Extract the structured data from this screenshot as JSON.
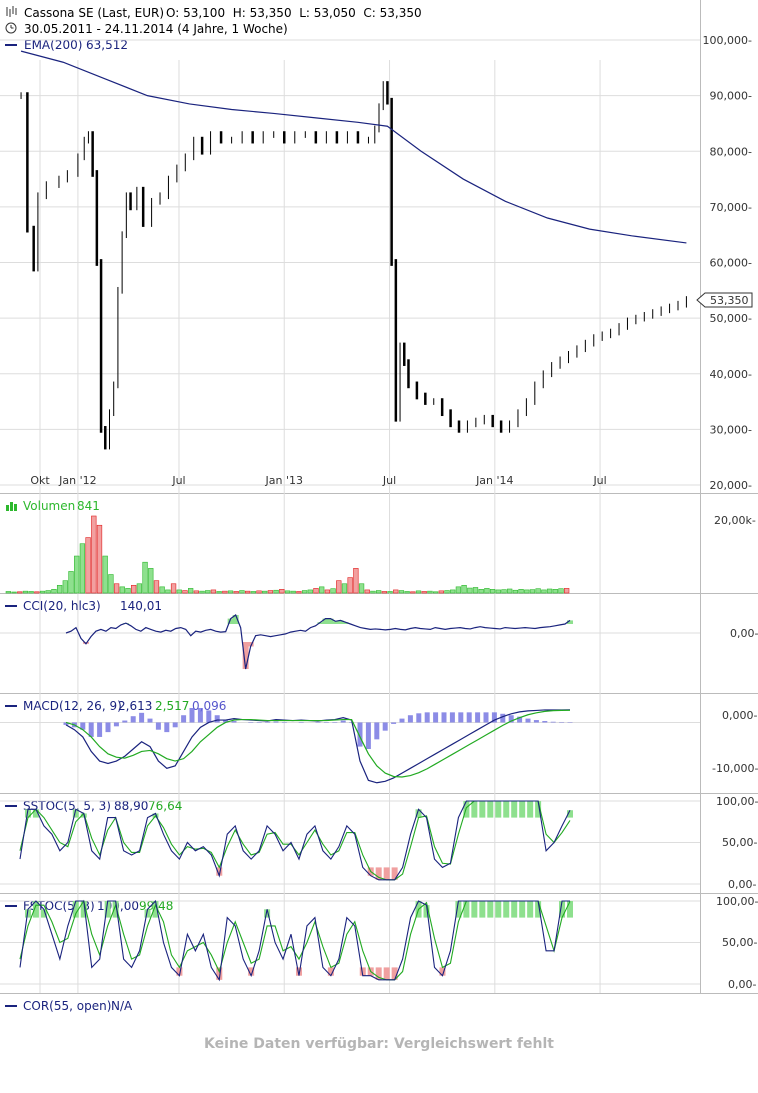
{
  "header": {
    "title": "Cassona SE (Last, EUR)",
    "ohlc": "O: 53,100  H: 53,350  L: 53,050  C: 53,350",
    "range": "30.05.2011 - 24.11.2014 (4 Jahre, 1 Woche)"
  },
  "colors": {
    "ema": "#1a237e",
    "volume_up": "#2db82d",
    "volume_down": "#e02020",
    "fill_positive": "#8ee08e",
    "fill_negative": "#f0a0a0",
    "macd_hist": "#6666dd",
    "signal": "#22aa22",
    "grid": "#dddddd"
  },
  "panels": {
    "price": {
      "ema_label": "EMA(200)",
      "ema_value": "63,512",
      "last_price_tag": "53,350",
      "y_ticks": [
        "100,000-",
        "90,000-",
        "80,000-",
        "70,000-",
        "60,000-",
        "50,000-",
        "40,000-",
        "30,000-",
        "20,000-"
      ],
      "x_ticks": [
        "Okt",
        "Jan '12",
        "Jul",
        "Jan '13",
        "Jul",
        "Jan '14",
        "Jul"
      ]
    },
    "volume": {
      "label": "Volumen",
      "value": "841",
      "y_ticks": [
        "20,00k-"
      ]
    },
    "cci": {
      "label": "CCI(20, hlc3)",
      "value": "140,01",
      "y_ticks": [
        "0,00-"
      ]
    },
    "macd": {
      "label": "MACD(12, 26, 9)",
      "value1": "2,613",
      "value2": "2,517",
      "value3": "0,096",
      "y_ticks": [
        "0,000-",
        "-10,000-"
      ]
    },
    "sstoc": {
      "label": "SSTOC(5, 5, 3)",
      "value1": "88,90",
      "value2": "76,64",
      "y_ticks": [
        "100,00-",
        "50,00-",
        "0,00-"
      ]
    },
    "fstoc": {
      "label": "FSTOC(5, 3)",
      "value1": "100,00",
      "value2": "99,48",
      "y_ticks": [
        "100,00-",
        "50,00-",
        "0,00-"
      ]
    },
    "cor": {
      "label": "COR(55, open)",
      "value": "N/A",
      "note": "Keine Daten verfügbar: Vergleichswert fehlt"
    }
  },
  "chart_data": [
    {
      "type": "line",
      "panel": "price",
      "ylim": [
        20,
        100
      ],
      "x_tick_positions": [
        0.09,
        0.27,
        0.75,
        1.25,
        1.75,
        2.25,
        2.75
      ],
      "xlim": [
        -0.1,
        3.5
      ],
      "close": [
        [
          0.0,
          90.0
        ],
        [
          0.03,
          66.0
        ],
        [
          0.06,
          59.0
        ],
        [
          0.08,
          72.0
        ],
        [
          0.12,
          74.0
        ],
        [
          0.18,
          75.0
        ],
        [
          0.22,
          76.0
        ],
        [
          0.27,
          79.0
        ],
        [
          0.3,
          82.0
        ],
        [
          0.32,
          83.0
        ],
        [
          0.34,
          76.0
        ],
        [
          0.36,
          60.0
        ],
        [
          0.38,
          30.0
        ],
        [
          0.4,
          27.0
        ],
        [
          0.42,
          33.0
        ],
        [
          0.44,
          38.0
        ],
        [
          0.46,
          55.0
        ],
        [
          0.48,
          65.0
        ],
        [
          0.5,
          72.0
        ],
        [
          0.52,
          70.0
        ],
        [
          0.55,
          73.0
        ],
        [
          0.58,
          67.0
        ],
        [
          0.62,
          71.0
        ],
        [
          0.66,
          72.0
        ],
        [
          0.7,
          75.0
        ],
        [
          0.74,
          77.0
        ],
        [
          0.78,
          79.0
        ],
        [
          0.82,
          82.0
        ],
        [
          0.86,
          80.0
        ],
        [
          0.9,
          83.0
        ],
        [
          0.95,
          82.0
        ],
        [
          1.0,
          82.0
        ],
        [
          1.05,
          83.0
        ],
        [
          1.1,
          82.0
        ],
        [
          1.15,
          83.0
        ],
        [
          1.2,
          83.0
        ],
        [
          1.25,
          82.0
        ],
        [
          1.3,
          83.0
        ],
        [
          1.35,
          83.0
        ],
        [
          1.4,
          82.0
        ],
        [
          1.45,
          83.0
        ],
        [
          1.5,
          82.0
        ],
        [
          1.55,
          83.0
        ],
        [
          1.6,
          82.0
        ],
        [
          1.65,
          82.0
        ],
        [
          1.68,
          84.0
        ],
        [
          1.7,
          88.0
        ],
        [
          1.72,
          92.0
        ],
        [
          1.74,
          89.0
        ],
        [
          1.76,
          60.0
        ],
        [
          1.78,
          32.0
        ],
        [
          1.8,
          45.0
        ],
        [
          1.82,
          42.0
        ],
        [
          1.84,
          38.0
        ],
        [
          1.88,
          36.0
        ],
        [
          1.92,
          35.0
        ],
        [
          1.96,
          35.0
        ],
        [
          2.0,
          33.0
        ],
        [
          2.04,
          31.0
        ],
        [
          2.08,
          30.0
        ],
        [
          2.12,
          31.0
        ],
        [
          2.16,
          31.5
        ],
        [
          2.2,
          32.0
        ],
        [
          2.24,
          31.0
        ],
        [
          2.28,
          30.0
        ],
        [
          2.32,
          31.0
        ],
        [
          2.36,
          33.0
        ],
        [
          2.4,
          35.0
        ],
        [
          2.44,
          38.0
        ],
        [
          2.48,
          40.0
        ],
        [
          2.52,
          41.5
        ],
        [
          2.56,
          42.5
        ],
        [
          2.6,
          43.5
        ],
        [
          2.64,
          44.5
        ],
        [
          2.68,
          45.5
        ],
        [
          2.72,
          46.5
        ],
        [
          2.76,
          47.0
        ],
        [
          2.8,
          47.5
        ],
        [
          2.84,
          48.5
        ],
        [
          2.88,
          49.5
        ],
        [
          2.92,
          50.0
        ],
        [
          2.96,
          50.5
        ],
        [
          3.0,
          51.0
        ],
        [
          3.04,
          51.5
        ],
        [
          3.08,
          52.0
        ],
        [
          3.12,
          52.5
        ],
        [
          3.16,
          53.35
        ]
      ],
      "ema200": [
        [
          0.0,
          98.0
        ],
        [
          0.2,
          96.0
        ],
        [
          0.4,
          93.0
        ],
        [
          0.6,
          90.0
        ],
        [
          0.8,
          88.5
        ],
        [
          1.0,
          87.5
        ],
        [
          1.2,
          86.8
        ],
        [
          1.4,
          86.0
        ],
        [
          1.6,
          85.2
        ],
        [
          1.74,
          84.5
        ],
        [
          1.9,
          80.0
        ],
        [
          2.1,
          75.0
        ],
        [
          2.3,
          71.0
        ],
        [
          2.5,
          68.0
        ],
        [
          2.7,
          66.0
        ],
        [
          2.9,
          64.8
        ],
        [
          3.16,
          63.512
        ]
      ]
    },
    {
      "type": "bar",
      "panel": "volume",
      "ylim": [
        0,
        25
      ],
      "values": [
        0.5,
        0.3,
        0.4,
        0.6,
        0.5,
        0.4,
        0.6,
        0.8,
        1.2,
        2.5,
        4.0,
        7.0,
        12.0,
        16.0,
        18.0,
        25.0,
        22.0,
        12.0,
        6.0,
        3.0,
        2.0,
        1.5,
        2.5,
        3.0,
        10.0,
        8.0,
        4.0,
        2.0,
        1.0,
        3.0,
        1.0,
        0.8,
        1.5,
        0.7,
        0.6,
        0.8,
        1.0,
        0.5,
        0.6,
        0.7,
        0.5,
        0.8,
        0.6,
        0.5,
        0.7,
        0.6,
        0.8,
        0.9,
        1.2,
        0.7,
        0.6,
        0.5,
        0.8,
        1.0,
        1.5,
        2.0,
        1.0,
        1.4,
        4.0,
        3.0,
        5.0,
        8.0,
        3.0,
        1.0,
        0.6,
        0.8,
        0.5,
        0.5,
        1.0,
        0.8,
        0.5,
        0.4,
        0.7,
        0.5,
        0.6,
        0.4,
        0.7,
        0.8,
        1.0,
        2.0,
        2.5,
        1.6,
        1.8,
        1.2,
        1.5,
        1.2,
        1.0,
        1.1,
        1.3,
        0.9,
        1.2,
        1.0,
        1.1,
        1.4,
        1.0,
        1.3,
        1.2,
        1.4,
        1.5
      ],
      "up": [
        1,
        1,
        0,
        1,
        1,
        0,
        1,
        1,
        1,
        1,
        1,
        1,
        1,
        1,
        0,
        0,
        0,
        1,
        1,
        0,
        1,
        1,
        0,
        1,
        1,
        1,
        0,
        1,
        1,
        0,
        1,
        0,
        1,
        0,
        1,
        1,
        0,
        1,
        0,
        1,
        0,
        1,
        0,
        1,
        0,
        1,
        0,
        1,
        0,
        1,
        1,
        0,
        1,
        1,
        0,
        1,
        0,
        1,
        0,
        1,
        0,
        0,
        1,
        0,
        1,
        1,
        0,
        1,
        0,
        1,
        1,
        0,
        1,
        0,
        1,
        1,
        0,
        1,
        1,
        1,
        1,
        1,
        1,
        1,
        1,
        1,
        1,
        1,
        1,
        1,
        1,
        1,
        1,
        1,
        1,
        1,
        1,
        1
      ]
    },
    {
      "type": "line",
      "panel": "cci",
      "ylim": [
        -300,
        300
      ],
      "values": [
        0,
        20,
        60,
        -60,
        -120,
        -40,
        20,
        40,
        20,
        60,
        50,
        90,
        110,
        80,
        40,
        20,
        60,
        40,
        20,
        10,
        30,
        20,
        50,
        60,
        40,
        -30,
        20,
        10,
        30,
        40,
        20,
        10,
        15,
        160,
        200,
        60,
        -400,
        -150,
        -30,
        -20,
        -30,
        -40,
        -30,
        -20,
        -10,
        10,
        20,
        30,
        20,
        60,
        80,
        120,
        160,
        160,
        130,
        140,
        120,
        100,
        80,
        60,
        50,
        40,
        45,
        40,
        35,
        40,
        50,
        40,
        35,
        50,
        60,
        50,
        45,
        40,
        60,
        50,
        40,
        50,
        55,
        60,
        50,
        45,
        60,
        70,
        60,
        55,
        50,
        45,
        60,
        55,
        50,
        55,
        60,
        55,
        50,
        60,
        65,
        70,
        80,
        90,
        100,
        140.01
      ]
    },
    {
      "type": "line",
      "panel": "macd",
      "ylim": [
        -14,
        3
      ],
      "macd": [
        -0.5,
        -1.5,
        -3.0,
        -6.0,
        -8.0,
        -8.5,
        -8.0,
        -7.0,
        -5.5,
        -4.0,
        -5.0,
        -8.0,
        -9.5,
        -9.0,
        -6.0,
        -3.0,
        -1.0,
        0.0,
        0.5,
        0.5,
        0.8,
        0.6,
        0.5,
        0.4,
        0.3,
        0.6,
        0.5,
        0.4,
        0.5,
        0.4,
        0.3,
        0.5,
        0.6,
        1.0,
        0.5,
        -8.0,
        -12.0,
        -12.5,
        -12.2,
        -11.5,
        -10.5,
        -9.5,
        -8.5,
        -7.5,
        -6.5,
        -5.5,
        -4.5,
        -3.5,
        -2.5,
        -1.5,
        -0.5,
        0.5,
        1.2,
        1.8,
        2.2,
        2.4,
        2.5,
        2.6,
        2.6,
        2.6,
        2.613
      ],
      "signal": [
        0.0,
        -0.5,
        -1.5,
        -3.0,
        -5.0,
        -6.5,
        -7.2,
        -7.4,
        -6.8,
        -6.0,
        -5.8,
        -6.5,
        -7.5,
        -8.0,
        -7.5,
        -6.0,
        -4.0,
        -2.5,
        -1.0,
        0.0,
        0.5,
        0.6,
        0.6,
        0.5,
        0.4,
        0.4,
        0.4,
        0.4,
        0.4,
        0.4,
        0.4,
        0.4,
        0.5,
        0.6,
        0.6,
        -3.0,
        -6.5,
        -9.0,
        -10.5,
        -11.2,
        -11.3,
        -11.0,
        -10.4,
        -9.6,
        -8.6,
        -7.6,
        -6.6,
        -5.6,
        -4.6,
        -3.6,
        -2.6,
        -1.6,
        -0.6,
        0.3,
        1.0,
        1.6,
        2.0,
        2.3,
        2.45,
        2.5,
        2.517
      ]
    },
    {
      "type": "line",
      "panel": "sstoc",
      "ylim": [
        0,
        100
      ],
      "k": [
        30,
        90,
        90,
        70,
        60,
        40,
        50,
        90,
        85,
        40,
        30,
        80,
        80,
        40,
        35,
        40,
        80,
        85,
        60,
        40,
        30,
        50,
        40,
        45,
        35,
        10,
        60,
        70,
        40,
        30,
        40,
        70,
        60,
        40,
        50,
        30,
        60,
        70,
        40,
        30,
        45,
        70,
        60,
        20,
        10,
        5,
        5,
        5,
        20,
        60,
        90,
        80,
        30,
        20,
        25,
        80,
        100,
        100,
        100,
        100,
        100,
        100,
        100,
        100,
        100,
        100,
        40,
        50,
        70,
        88.9
      ],
      "d": [
        40,
        80,
        90,
        80,
        65,
        50,
        45,
        75,
        85,
        55,
        35,
        65,
        80,
        50,
        38,
        38,
        70,
        82,
        68,
        48,
        35,
        45,
        42,
        43,
        38,
        20,
        45,
        65,
        48,
        35,
        38,
        60,
        62,
        48,
        48,
        35,
        50,
        65,
        48,
        35,
        40,
        62,
        62,
        35,
        15,
        8,
        5,
        5,
        12,
        45,
        80,
        82,
        45,
        25,
        24,
        60,
        92,
        100,
        100,
        100,
        100,
        100,
        100,
        100,
        100,
        100,
        60,
        50,
        62,
        76.64
      ]
    },
    {
      "type": "line",
      "panel": "fstoc",
      "ylim": [
        0,
        100
      ],
      "k": [
        20,
        90,
        100,
        90,
        60,
        30,
        70,
        100,
        100,
        20,
        30,
        100,
        100,
        30,
        20,
        40,
        90,
        100,
        50,
        20,
        10,
        60,
        40,
        60,
        20,
        5,
        80,
        70,
        30,
        10,
        40,
        90,
        50,
        30,
        60,
        10,
        70,
        80,
        20,
        10,
        30,
        80,
        70,
        10,
        10,
        5,
        5,
        5,
        30,
        80,
        100,
        95,
        20,
        10,
        40,
        100,
        100,
        100,
        100,
        100,
        100,
        100,
        100,
        100,
        100,
        100,
        40,
        40,
        100,
        100
      ],
      "d": [
        30,
        70,
        95,
        95,
        75,
        50,
        55,
        85,
        100,
        60,
        35,
        70,
        95,
        60,
        30,
        35,
        70,
        95,
        75,
        35,
        20,
        40,
        45,
        50,
        35,
        15,
        50,
        75,
        50,
        25,
        30,
        70,
        70,
        40,
        45,
        30,
        50,
        75,
        45,
        20,
        25,
        60,
        75,
        40,
        15,
        8,
        5,
        5,
        15,
        60,
        90,
        98,
        55,
        20,
        25,
        75,
        100,
        100,
        100,
        100,
        100,
        100,
        100,
        100,
        100,
        100,
        70,
        40,
        80,
        99.48
      ]
    }
  ]
}
